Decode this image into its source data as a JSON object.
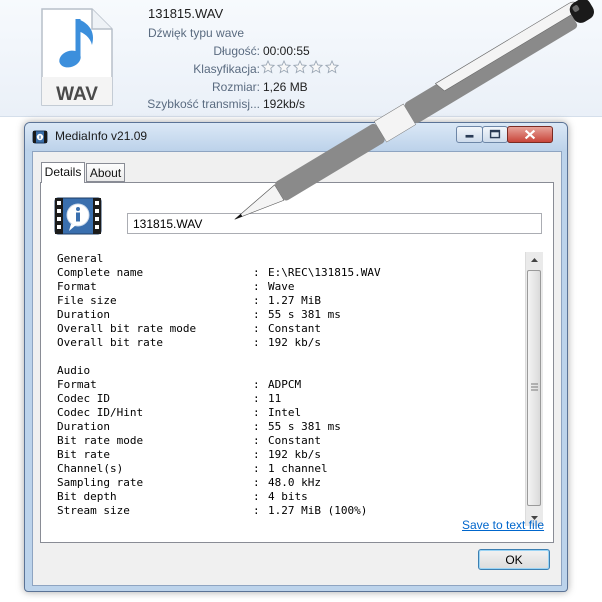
{
  "explorer": {
    "file_icon_name": "wav-audio-file-icon",
    "file_icon_text": "WAV",
    "file_name": "131815.WAV",
    "file_type": "Dźwięk typu wave",
    "length_label": "Długość:",
    "length_value": "00:00:55",
    "rating_label": "Klasyfikacja:",
    "rating_stars": 0,
    "size_label": "Rozmiar:",
    "size_value": "1,26 MB",
    "bitrate_label": "Szybkość transmisj...",
    "bitrate_value": "192kb/s"
  },
  "window": {
    "title": "MediaInfo v21.09",
    "icon_name": "mediainfo-app-icon"
  },
  "tabs": [
    {
      "label": "Details",
      "selected": true
    },
    {
      "label": "About",
      "selected": false
    }
  ],
  "filename_field": "131815.WAV",
  "report": {
    "general_header": "General",
    "general": [
      {
        "label": "Complete name",
        "value": "E:\\REC\\131815.WAV"
      },
      {
        "label": "Format",
        "value": "Wave"
      },
      {
        "label": "File size",
        "value": "1.27 MiB"
      },
      {
        "label": "Duration",
        "value": "55 s 381 ms"
      },
      {
        "label": "Overall bit rate mode",
        "value": "Constant"
      },
      {
        "label": "Overall bit rate",
        "value": "192 kb/s"
      }
    ],
    "audio_header": "Audio",
    "audio": [
      {
        "label": "Format",
        "value": "ADPCM"
      },
      {
        "label": "Codec ID",
        "value": "11"
      },
      {
        "label": "Codec ID/Hint",
        "value": "Intel"
      },
      {
        "label": "Duration",
        "value": "55 s 381 ms"
      },
      {
        "label": "Bit rate mode",
        "value": "Constant"
      },
      {
        "label": "Bit rate",
        "value": "192 kb/s"
      },
      {
        "label": "Channel(s)",
        "value": "1 channel"
      },
      {
        "label": "Sampling rate",
        "value": "48.0 kHz"
      },
      {
        "label": "Bit depth",
        "value": "4 bits"
      },
      {
        "label": "Stream size",
        "value": "1.27 MiB (100%)"
      }
    ]
  },
  "save_link": "Save to text file",
  "ok_label": "OK",
  "colors": {
    "link": "#0066cc",
    "wav_note": "#3c8fdc",
    "title_bar": "#bcd3eb",
    "close_button": "#c8453a"
  }
}
